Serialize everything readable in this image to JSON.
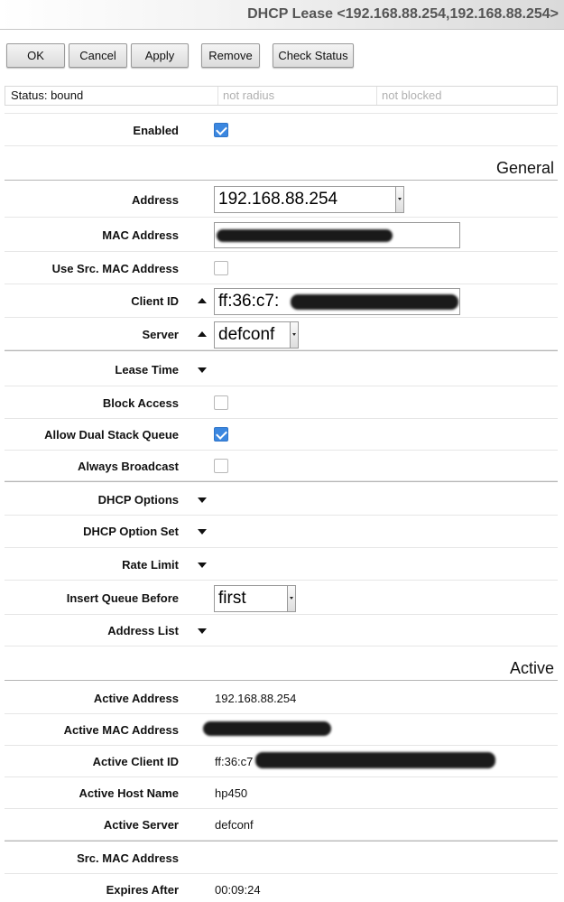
{
  "title": "DHCP Lease <192.168.88.254,192.168.88.254>",
  "toolbar": {
    "ok": "OK",
    "cancel": "Cancel",
    "apply": "Apply",
    "remove": "Remove",
    "check_status": "Check Status"
  },
  "status": {
    "state": "Status: bound",
    "radius": "not radius",
    "blocked": "not blocked"
  },
  "fields": {
    "enabled": {
      "label": "Enabled",
      "checked": true
    },
    "address": {
      "label": "Address",
      "value": "192.168.88.254"
    },
    "mac_address": {
      "label": "MAC Address"
    },
    "use_src_mac": {
      "label": "Use Src. MAC Address",
      "checked": false
    },
    "client_id": {
      "label": "Client ID",
      "value": "ff:36:c7:"
    },
    "server": {
      "label": "Server",
      "value": "defconf"
    },
    "lease_time": {
      "label": "Lease Time"
    },
    "block_access": {
      "label": "Block Access",
      "checked": false
    },
    "allow_dual_stack_queue": {
      "label": "Allow Dual Stack Queue",
      "checked": true
    },
    "always_broadcast": {
      "label": "Always Broadcast",
      "checked": false
    },
    "dhcp_options": {
      "label": "DHCP Options"
    },
    "dhcp_option_set": {
      "label": "DHCP Option Set"
    },
    "rate_limit": {
      "label": "Rate Limit"
    },
    "insert_queue_before": {
      "label": "Insert Queue Before",
      "value": "first"
    },
    "address_list": {
      "label": "Address List"
    }
  },
  "sections": {
    "general": "General",
    "active": "Active"
  },
  "active": {
    "address": {
      "label": "Active Address",
      "value": "192.168.88.254"
    },
    "mac_address": {
      "label": "Active MAC Address"
    },
    "client_id": {
      "label": "Active Client ID",
      "value": "ff:36:c7"
    },
    "host_name": {
      "label": "Active Host Name",
      "value": "hp450"
    },
    "server": {
      "label": "Active Server",
      "value": "defconf"
    }
  },
  "extra": {
    "src_mac_address": {
      "label": "Src. MAC Address"
    },
    "expires_after": {
      "label": "Expires After",
      "value": "00:09:24"
    }
  },
  "colors": {
    "checkbox_on": "#3b87e0",
    "title_text": "#555555"
  }
}
